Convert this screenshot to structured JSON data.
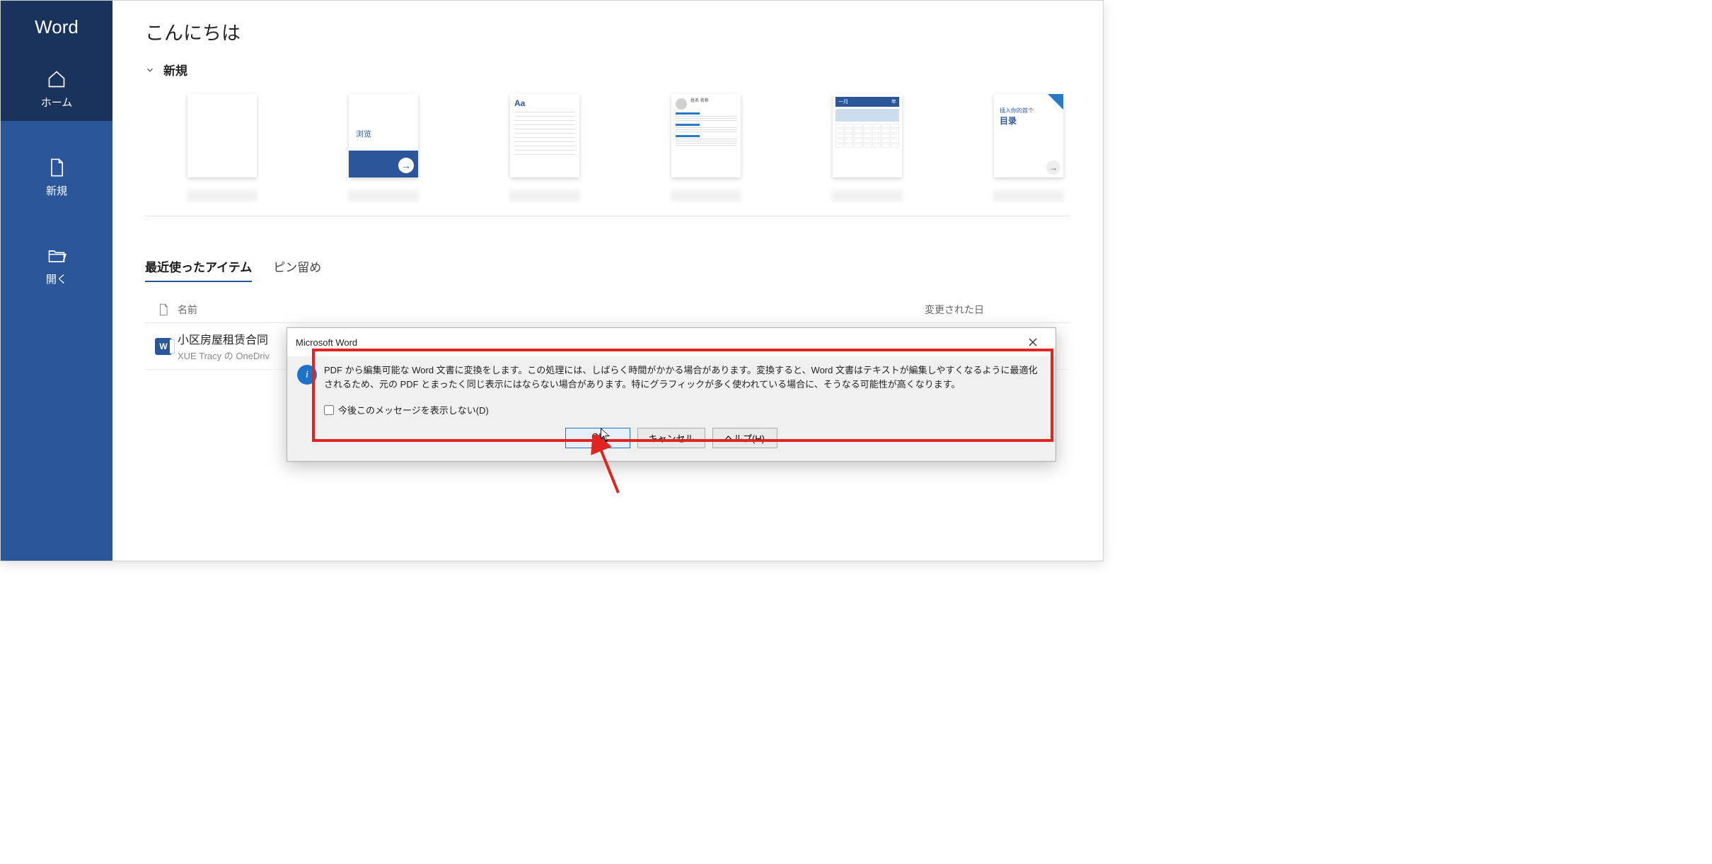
{
  "app_name": "Word",
  "sidebar": {
    "items": [
      {
        "label": "ホーム",
        "icon": "home-icon",
        "active": true
      },
      {
        "label": "新規",
        "icon": "new-doc-icon",
        "active": false
      },
      {
        "label": "開く",
        "icon": "open-folder-icon",
        "active": false
      }
    ]
  },
  "main": {
    "greeting": "こんにちは",
    "section_new": "新規",
    "templates": [
      {
        "name": "白紙の文書"
      },
      {
        "name": "Word へようこそ",
        "thumb_text": "浏览"
      },
      {
        "name": "シングル スペース",
        "thumb_text": "Aa"
      },
      {
        "name": "履歴書",
        "thumb_text": "姓名 名称"
      },
      {
        "name": "カレンダー",
        "thumb_month": "一月",
        "thumb_year": "年"
      },
      {
        "name": "目次の挿入",
        "thumb_line1": "插入你的首个",
        "thumb_line2": "目录"
      }
    ],
    "tabs": [
      {
        "label": "最近使ったアイテム",
        "active": true
      },
      {
        "label": "ピン留め",
        "active": false
      }
    ],
    "list": {
      "col_name": "名前",
      "col_date": "変更された日",
      "files": [
        {
          "name": "小区房屋租赁合同",
          "path": "XUE Tracy の OneDriv"
        }
      ]
    }
  },
  "dialog": {
    "title": "Microsoft Word",
    "message": "PDF から編集可能な Word 文書に変換をします。この処理には、しばらく時間がかかる場合があります。変換すると、Word 文書はテキストが編集しやすくなるように最適化されるため、元の PDF とまったく同じ表示にはならない場合があります。特にグラフィックが多く使われている場合に、そうなる可能性が高くなります。",
    "checkbox_label": "今後このメッセージを表示しない(D)",
    "buttons": {
      "ok": "OK",
      "cancel": "キャンセル",
      "help": "ヘルプ(H)"
    }
  }
}
